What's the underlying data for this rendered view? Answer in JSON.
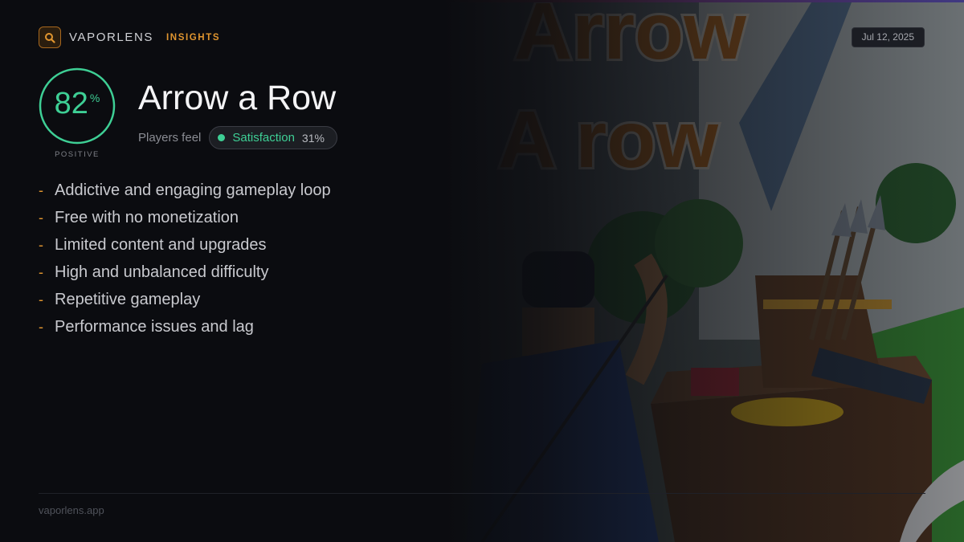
{
  "brand": {
    "name": "VAPORLENS",
    "tag": "INSIGHTS",
    "icon": "search-icon"
  },
  "date": "Jul 12, 2025",
  "score": {
    "value": "82",
    "unit": "%",
    "label": "POSITIVE",
    "fraction": 0.82
  },
  "game": {
    "title": "Arrow a Row"
  },
  "sentiment": {
    "prefix": "Players feel",
    "name": "Satisfaction",
    "value": "31%"
  },
  "points": [
    "Addictive and engaging gameplay loop",
    "Free with no monetization",
    "Limited content and upgrades",
    "High and unbalanced difficulty",
    "Repetitive gameplay",
    "Performance issues and lag"
  ],
  "footer": {
    "url": "vaporlens.app"
  },
  "art": {
    "logo_text_line1": "Arrow",
    "logo_text_line2": "A row"
  },
  "colors": {
    "accent": "#e0952f",
    "positive": "#3ecf95",
    "background": "#0b0c10"
  }
}
